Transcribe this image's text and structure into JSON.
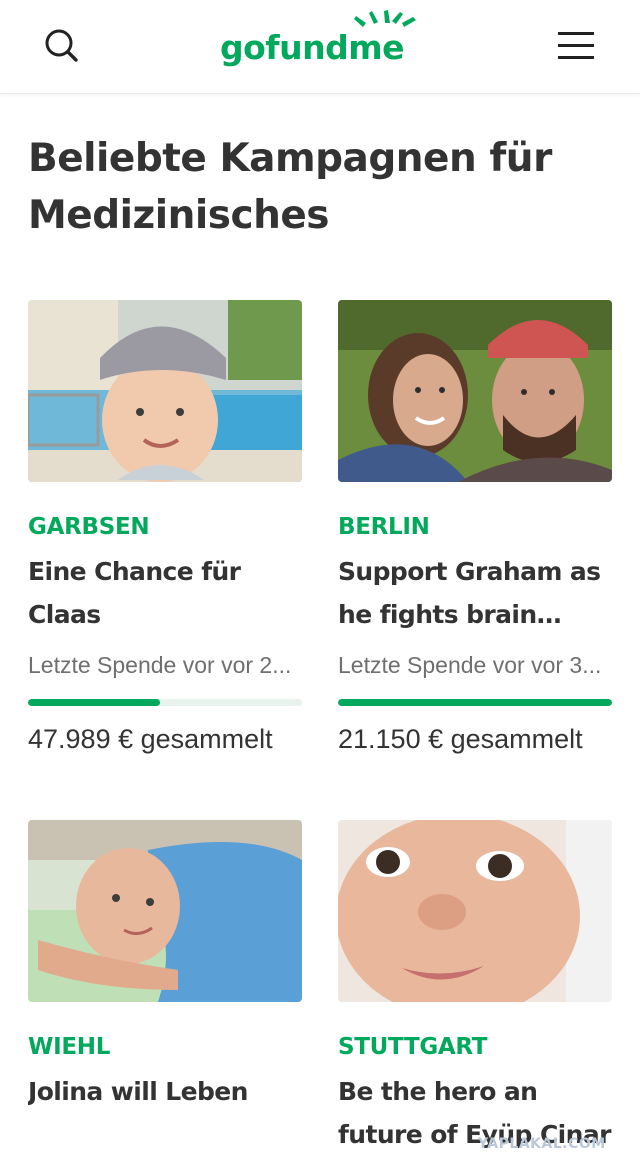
{
  "header": {
    "logo_text": "gofundme",
    "logo_color": "#02a95c",
    "icons": {
      "search": "search-icon",
      "menu": "hamburger-menu-icon"
    }
  },
  "section": {
    "title": "Beliebte Kampagnen für Medizinisches"
  },
  "campaigns": [
    {
      "location": "GARBSEN",
      "title": "Eine Chance für Claas",
      "last_donation": "Letzte Spende vor vor 2...",
      "raised": "47.989 € gesammelt",
      "progress": 0.48,
      "image": "photo-boy-with-cap-at-pool"
    },
    {
      "location": "BERLIN",
      "title": "Support Graham as he fights brain canc...",
      "last_donation": "Letzte Spende vor vor 3...",
      "raised": "21.150 € gesammelt",
      "progress": 1.0,
      "image": "photo-couple-selfie-outdoors"
    },
    {
      "location": "WIEHL",
      "title": "Jolina will Leben",
      "image": "photo-girl-lying-on-pillow"
    },
    {
      "location": "STUTTGART",
      "title": "Be the hero an future of Eyüp Cinar",
      "image": "photo-baby-face-closeup"
    }
  ],
  "accent_color": "#02a95c",
  "watermark": "YAPLAKAL.COM"
}
